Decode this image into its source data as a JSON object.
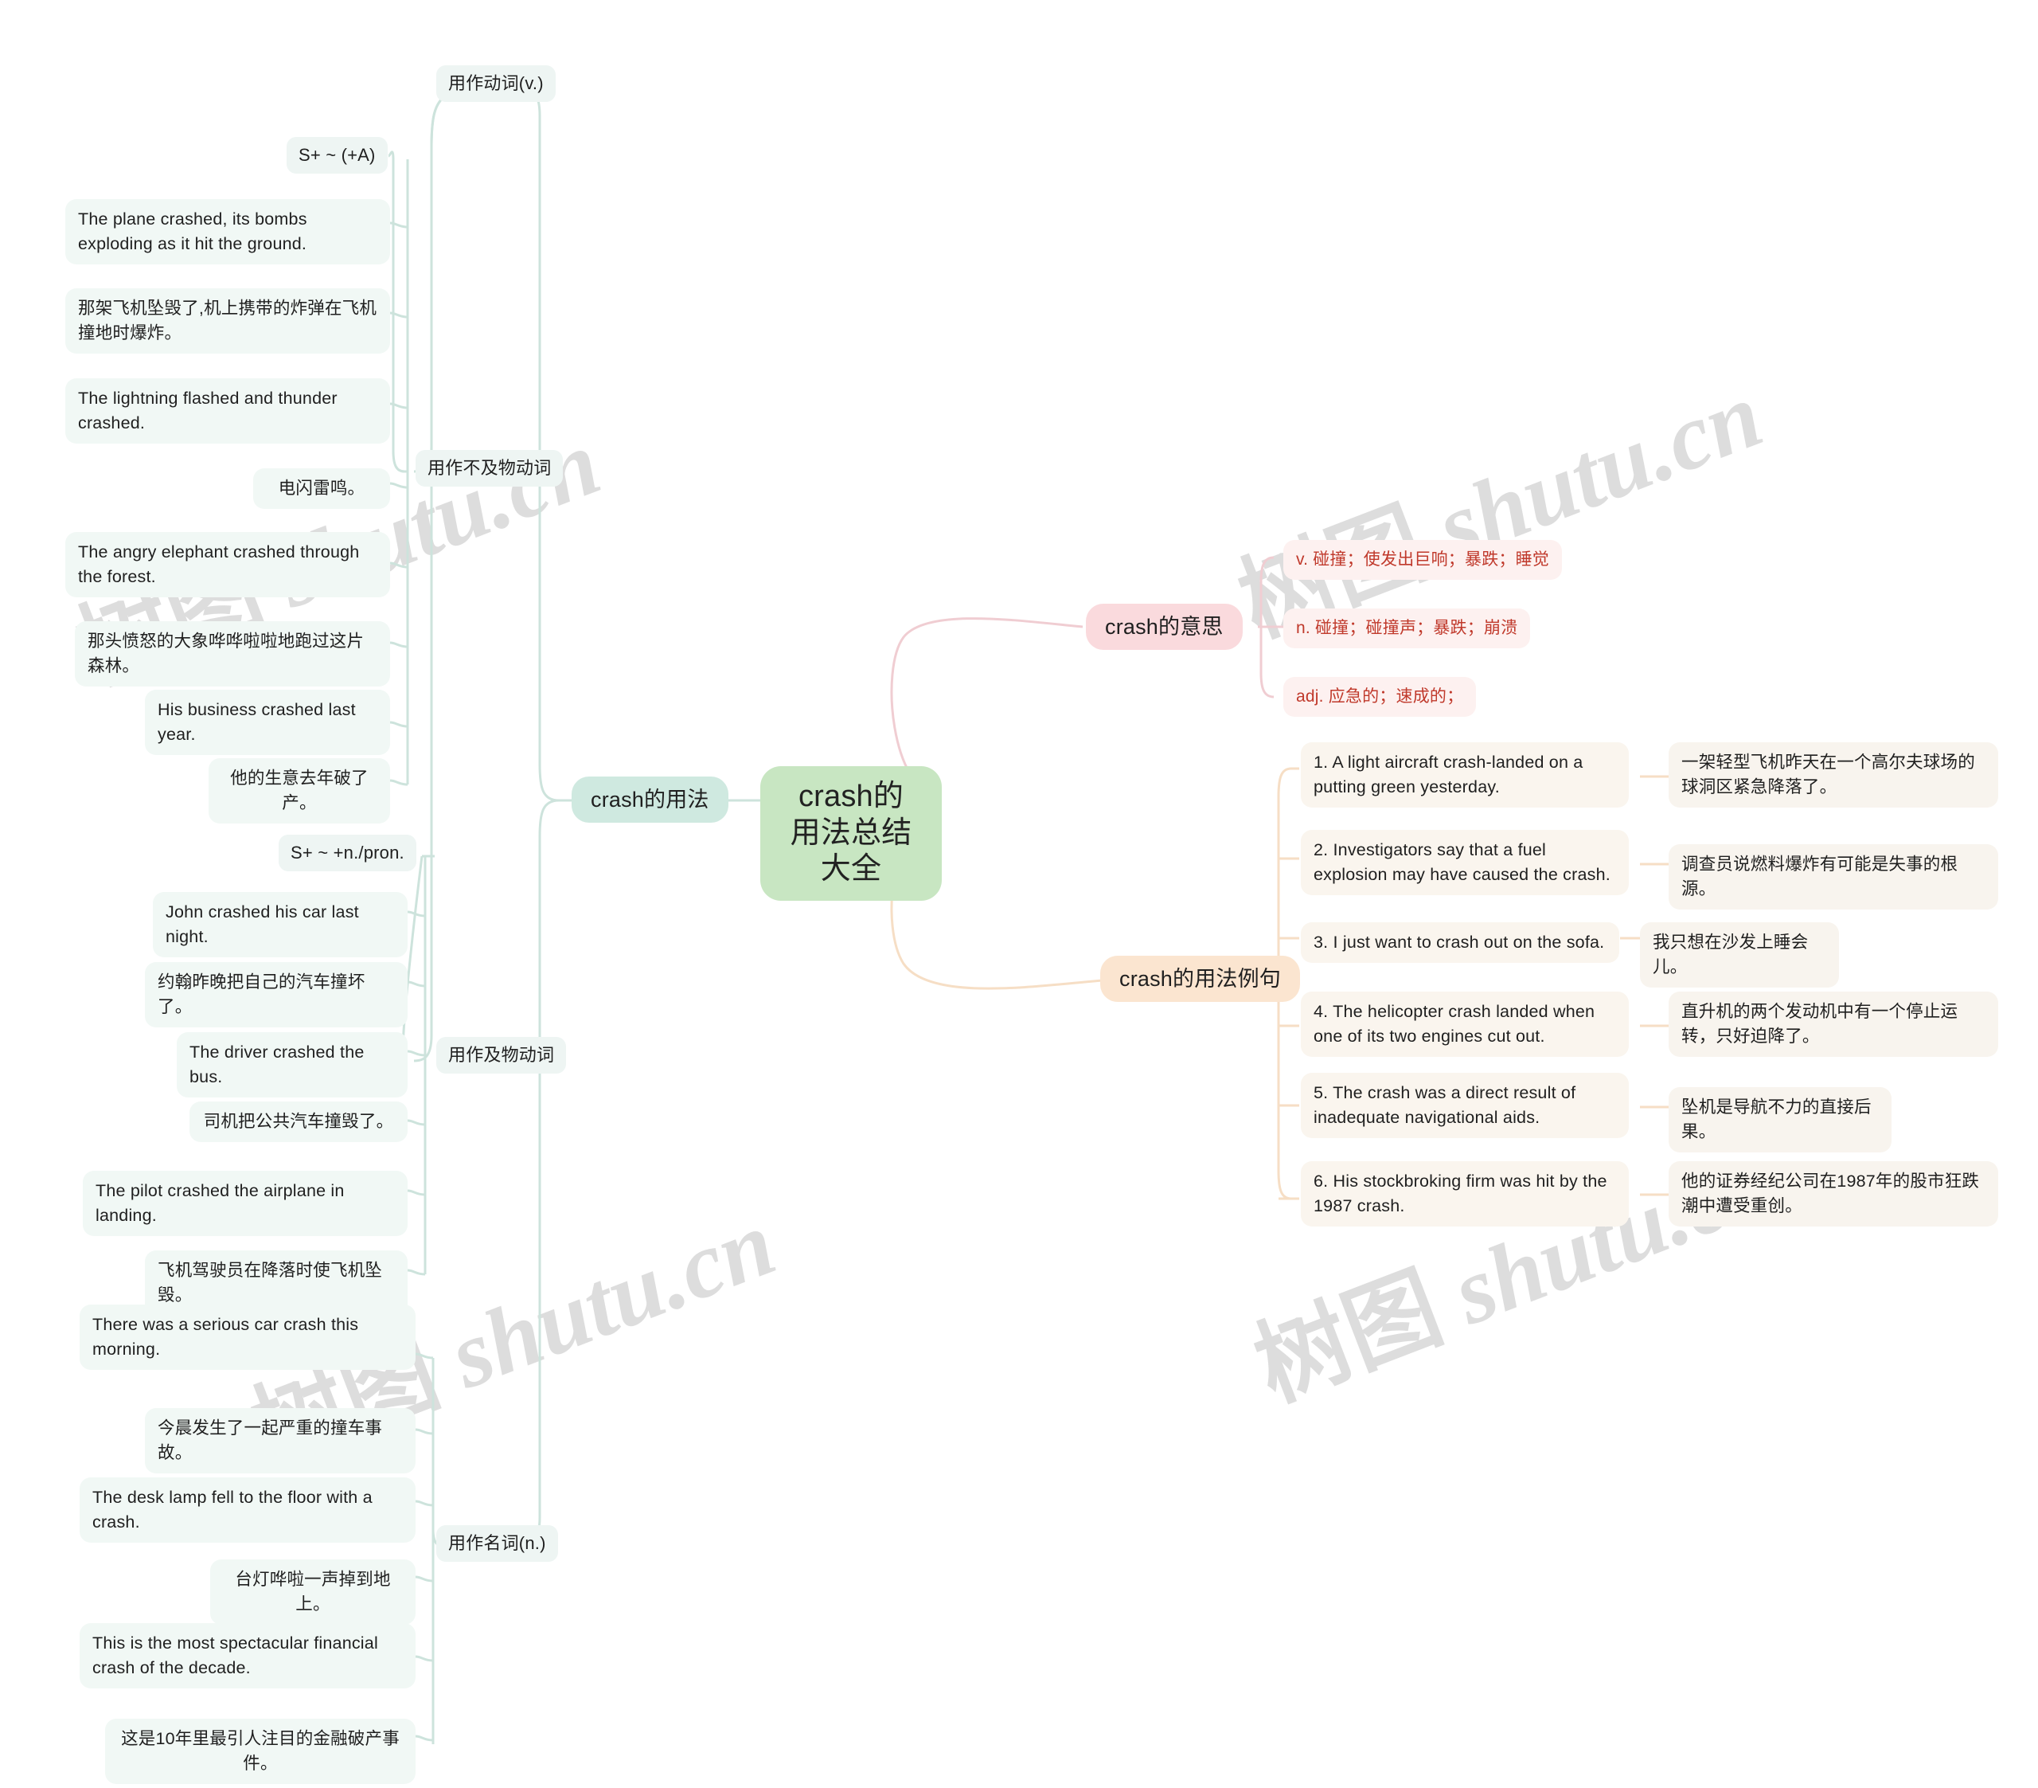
{
  "meta": {
    "watermark_text_cjk": "树图",
    "watermark_text_latin": "shutu.cn",
    "colors": {
      "root_bg": "#c8e6c2",
      "usage_bg": "#cfe9e0",
      "meaning_bg": "#fadadd",
      "examples_bg": "#fbe5d0",
      "meaning_text": "#c0392b",
      "link_green": "#cde3dc",
      "link_pink": "#f0cdd2",
      "link_peach": "#f6dec5"
    }
  },
  "root": {
    "label": "crash的用法总结大全"
  },
  "branches": {
    "usage": {
      "label": "crash的用法",
      "groups": [
        {
          "label": "用作动词(v.)",
          "subgroups": [
            {
              "label": "用作不及物动词",
              "patterns": [
                {
                  "label": "S+ ~ (+A)",
                  "items": [
                    "The plane crashed, its bombs exploding as it hit the ground.",
                    "那架飞机坠毁了,机上携带的炸弹在飞机撞地时爆炸。",
                    "The lightning flashed and thunder crashed.",
                    "电闪雷鸣。",
                    "The angry elephant crashed through the forest.",
                    "那头愤怒的大象哗哗啦啦地跑过这片森林。",
                    "His business crashed last year.",
                    "他的生意去年破了产。"
                  ]
                }
              ]
            },
            {
              "label": "用作及物动词",
              "patterns": [
                {
                  "label": "S+ ~ +n./pron.",
                  "items": [
                    "John crashed his car last night.",
                    "约翰昨晚把自己的汽车撞坏了。",
                    "The driver crashed the bus.",
                    "司机把公共汽车撞毁了。",
                    "The pilot crashed the airplane in landing.",
                    "飞机驾驶员在降落时使飞机坠毁。"
                  ]
                }
              ]
            }
          ]
        },
        {
          "label": "用作名词(n.)",
          "items": [
            "There was a serious car crash this morning.",
            "今晨发生了一起严重的撞车事故。",
            "The desk lamp fell to the floor with a crash.",
            "台灯哗啦一声掉到地上。",
            "This is the most spectacular financial crash of the decade.",
            "这是10年里最引人注目的金融破产事件。"
          ]
        }
      ]
    },
    "meaning": {
      "label": "crash的意思",
      "items": [
        "v. 碰撞；使发出巨响；暴跌；睡觉",
        "n. 碰撞；碰撞声；暴跌；崩溃",
        "adj. 应急的；速成的；"
      ]
    },
    "examples": {
      "label": "crash的用法例句",
      "items": [
        {
          "en": "1. A light aircraft crash-landed on a putting green yesterday.",
          "zh": "一架轻型飞机昨天在一个高尔夫球场的球洞区紧急降落了。"
        },
        {
          "en": "2. Investigators say that a fuel explosion may have caused the crash.",
          "zh": "调查员说燃料爆炸有可能是失事的根源。"
        },
        {
          "en": "3. I just want to crash out on the sofa.",
          "zh": "我只想在沙发上睡会儿。"
        },
        {
          "en": "4. The helicopter crash landed when one of its two engines cut out.",
          "zh": "直升机的两个发动机中有一个停止运转，只好迫降了。"
        },
        {
          "en": "5. The crash was a direct result of inadequate navigational aids.",
          "zh": "坠机是导航不力的直接后果。"
        },
        {
          "en": "6. His stockbroking firm was hit by the 1987 crash.",
          "zh": "他的证券经纪公司在1987年的股市狂跌潮中遭受重创。"
        }
      ]
    }
  }
}
